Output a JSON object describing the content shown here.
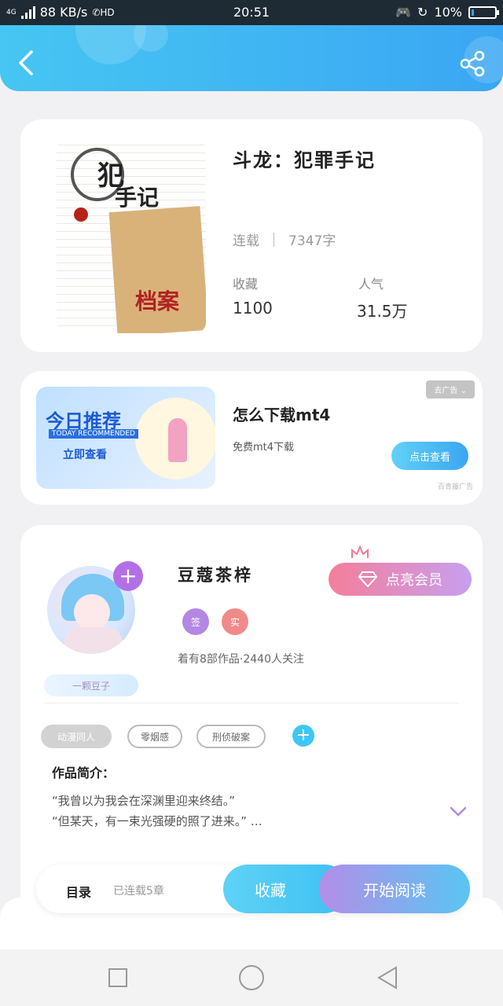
{
  "statusbar": {
    "network": "4G",
    "speed": "88 KB/s",
    "hd": "HD",
    "time": "20:51",
    "battery": "10%",
    "battery_level": 0.1
  },
  "header": {
    "back_icon": "chevron-left-icon",
    "share_icon": "share-icon"
  },
  "book": {
    "title": "斗龙：犯罪手记",
    "status": "连载",
    "word_count": "7347字",
    "collect_label": "收藏",
    "collect_value": "1100",
    "popularity_label": "人气",
    "popularity_value": "31.5万",
    "cover": {
      "title_top": "犯",
      "title_side": "手记",
      "title_bottom": "档案"
    }
  },
  "ad": {
    "image_title": "今日推荐",
    "image_subtitle": "TODAY RECOMMENDED",
    "image_cta": "立即查看",
    "title": "怎么下载mt4",
    "subtitle": "免费mt4下载",
    "remove_label": "去广告",
    "button_label": "点击查看",
    "source": "百青藤广告"
  },
  "author": {
    "name": "豆蔻茶梓",
    "badge": "一颗豆子",
    "tag_sign": "签",
    "tag_real": "实",
    "meta": "着有8部作品·2440人关注",
    "vip_button": "点亮会员",
    "genres": [
      "动漫同人",
      "零烟感",
      "刑侦破案"
    ],
    "intro_title": "作品简介：",
    "intro_lines": [
      "“我曾以为我会在深渊里迎来终结。”",
      "“但某天，有一束光强硬的照了进来。” …"
    ]
  },
  "bottom": {
    "toc_label": "目录",
    "toc_count": "已连载5章",
    "collect_button": "收藏",
    "read_button": "开始阅读"
  },
  "colors": {
    "header_start": "#46c6f2",
    "header_end": "#3aa6f3",
    "vip_start": "#f47e9a",
    "vip_end": "#c79ff0",
    "accent_purple": "#b36fe6"
  }
}
